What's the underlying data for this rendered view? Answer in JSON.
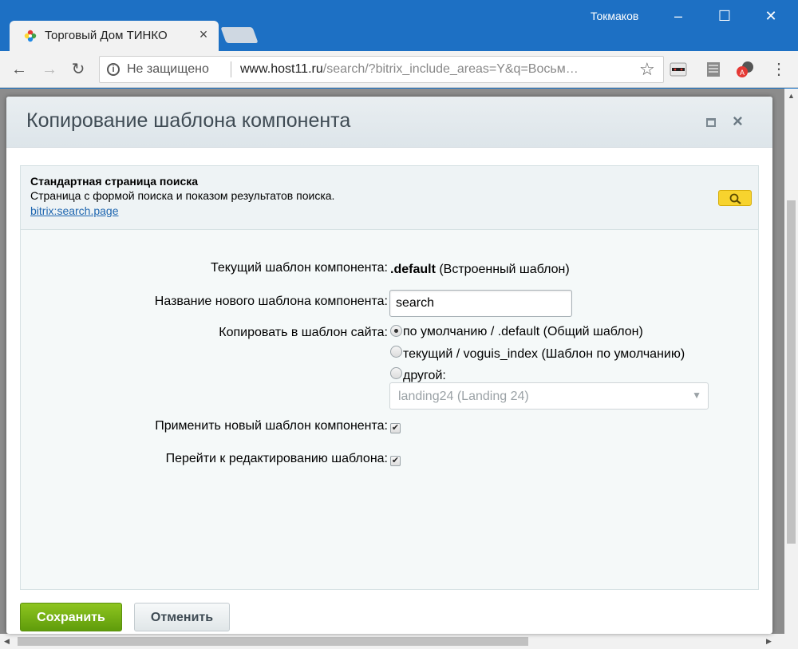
{
  "browser": {
    "tab_title": "Торговый Дом ТИНКО",
    "tab_close": "×",
    "user_name": "Токмаков",
    "minimize": "–",
    "maximize": "☐",
    "close": "✕",
    "security_label": "Не защищено",
    "url_host": "www.host11.ru",
    "url_path": "/search/?bitrix_include_areas=Y&q=Восьм…",
    "icons": [
      "back-icon",
      "forward-icon",
      "reload-icon",
      "info-icon",
      "star-icon",
      "incognito-icon",
      "reader-icon",
      "translate-icon",
      "menu-icon"
    ]
  },
  "dialog": {
    "title": "Копирование шаблона компонента",
    "component": {
      "name": "Стандартная страница поиска",
      "description": "Страница с формой поиска и показом результатов поиска.",
      "link": "bitrix:search.page"
    },
    "form": {
      "current_template_label": "Текущий шаблон компонента:",
      "current_template_name": ".default",
      "current_template_note": "(Встроенный шаблон)",
      "new_name_label": "Название нового шаблона компонента:",
      "new_name_value": "search",
      "copy_to_label": "Копировать в шаблон сайта:",
      "radio_options": [
        {
          "label": "по умолчанию / .default (Общий шаблон)",
          "checked": true
        },
        {
          "label": "текущий / voguis_index (Шаблон по умолчанию)",
          "checked": false
        },
        {
          "label": "другой:",
          "checked": false
        }
      ],
      "other_select_value": "landing24 (Landing 24)",
      "apply_label": "Применить новый шаблон компонента:",
      "apply_checked": true,
      "edit_label": "Перейти к редактированию шаблона:",
      "edit_checked": true
    },
    "buttons": {
      "save": "Сохранить",
      "cancel": "Отменить"
    }
  },
  "colors": {
    "titlebar": "#1d70c4",
    "save_button": "#6fae14",
    "link": "#2067b0"
  }
}
